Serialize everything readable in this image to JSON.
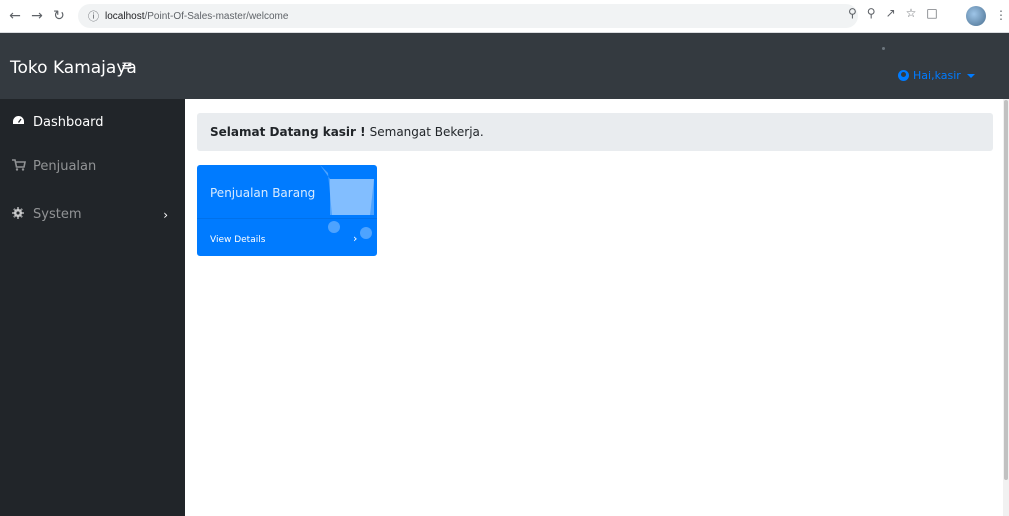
{
  "browser": {
    "back_icon": "arrow-left-icon",
    "forward_icon": "arrow-right-icon",
    "reload_icon": "reload-icon",
    "info_icon": "info-icon",
    "url_host": "localhost",
    "url_path": "/Point-Of-Sales-master/welcome"
  },
  "navbar": {
    "brand": "Toko Kamajaya",
    "user_label": "Hai,kasir"
  },
  "sidebar": {
    "items": [
      {
        "label": "Dashboard",
        "icon": "tachometer-icon"
      },
      {
        "label": "Penjualan",
        "icon": "cart-icon"
      },
      {
        "label": "System",
        "icon": "gear-icon"
      }
    ]
  },
  "main": {
    "welcome_bold": "Selamat Datang kasir !",
    "welcome_text": "Semangat Bekerja.",
    "card": {
      "title": "Penjualan Barang",
      "link": "View Details"
    }
  },
  "colors": {
    "navbar": "#343a40",
    "sidebar": "#212529",
    "primary": "#007bff",
    "alert_bg": "#e9ecef"
  }
}
